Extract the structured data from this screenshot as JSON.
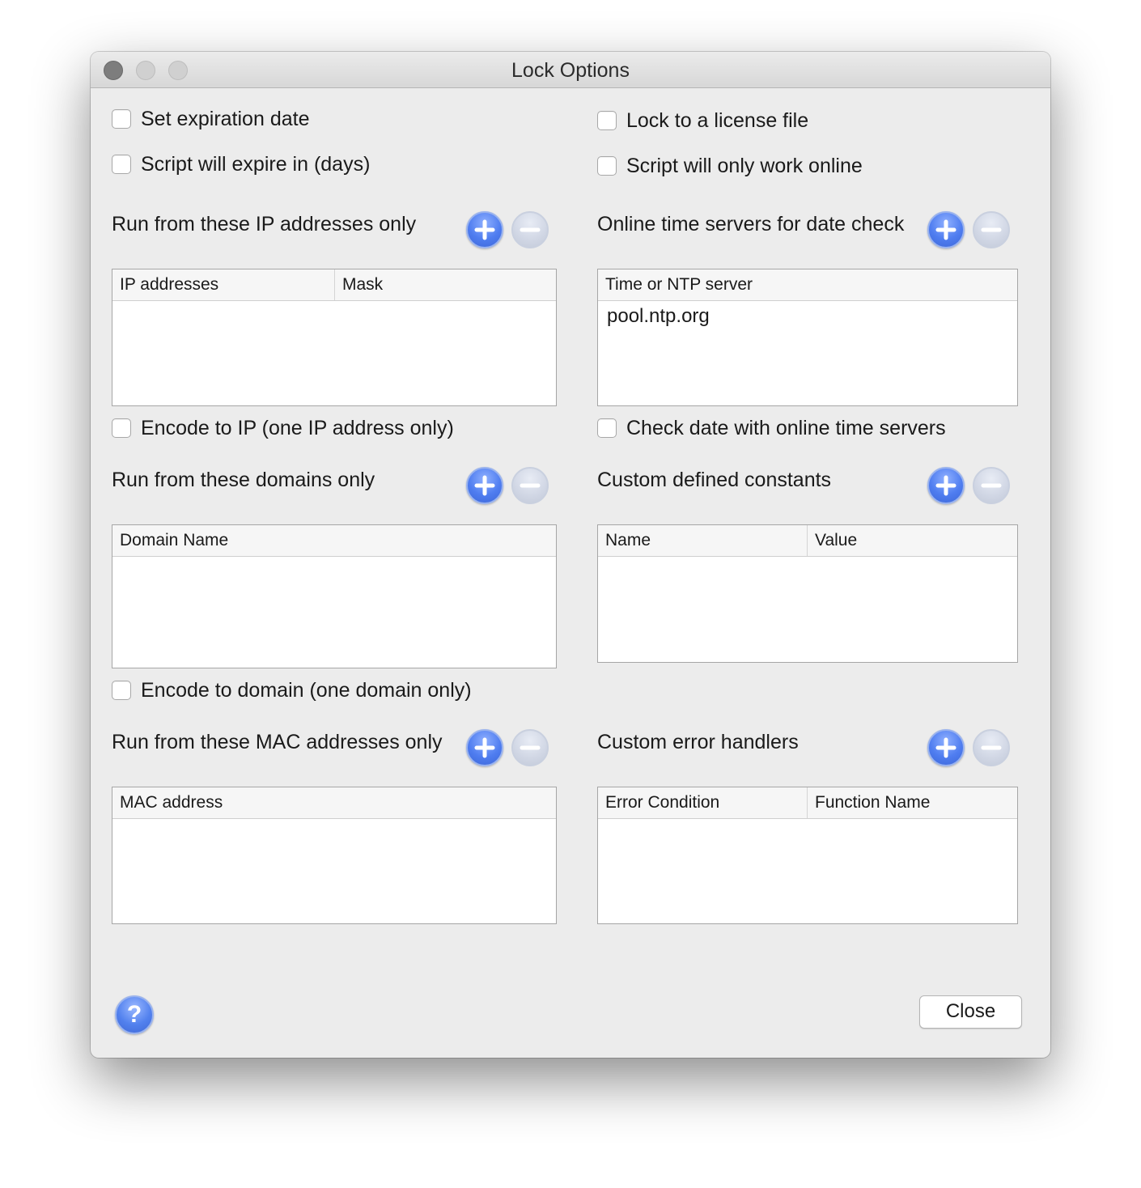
{
  "window": {
    "title": "Lock Options"
  },
  "options": {
    "set_expiration": "Set expiration date",
    "expire_days": "Script will expire in (days)",
    "lock_license": "Lock to a license file",
    "online_only": "Script will only work online",
    "encode_ip": "Encode to IP (one IP address only)",
    "check_date_online": "Check date with online time servers",
    "encode_domain": "Encode to domain (one domain only)"
  },
  "sections": {
    "ip": {
      "title": "Run from these IP addresses only",
      "columns": [
        "IP addresses",
        "Mask"
      ],
      "rows": []
    },
    "time_servers": {
      "title": "Online time servers for date check",
      "columns": [
        "Time or NTP server"
      ],
      "rows": [
        "pool.ntp.org"
      ]
    },
    "domains": {
      "title": "Run from these domains only",
      "columns": [
        "Domain Name"
      ],
      "rows": []
    },
    "constants": {
      "title": "Custom defined constants",
      "columns": [
        "Name",
        "Value"
      ],
      "rows": []
    },
    "mac": {
      "title": "Run from these MAC addresses only",
      "columns": [
        "MAC address"
      ],
      "rows": []
    },
    "errors": {
      "title": "Custom error handlers",
      "columns": [
        "Error Condition",
        "Function Name"
      ],
      "rows": []
    }
  },
  "footer": {
    "help": "?",
    "close": "Close"
  },
  "icons": {
    "add": "plus-circle-icon",
    "remove": "minus-circle-icon",
    "help": "question-mark-icon"
  },
  "colors": {
    "accent_blue": "#4f7df0",
    "window_bg": "#ececec",
    "disabled_gray": "#d0d6e4"
  }
}
